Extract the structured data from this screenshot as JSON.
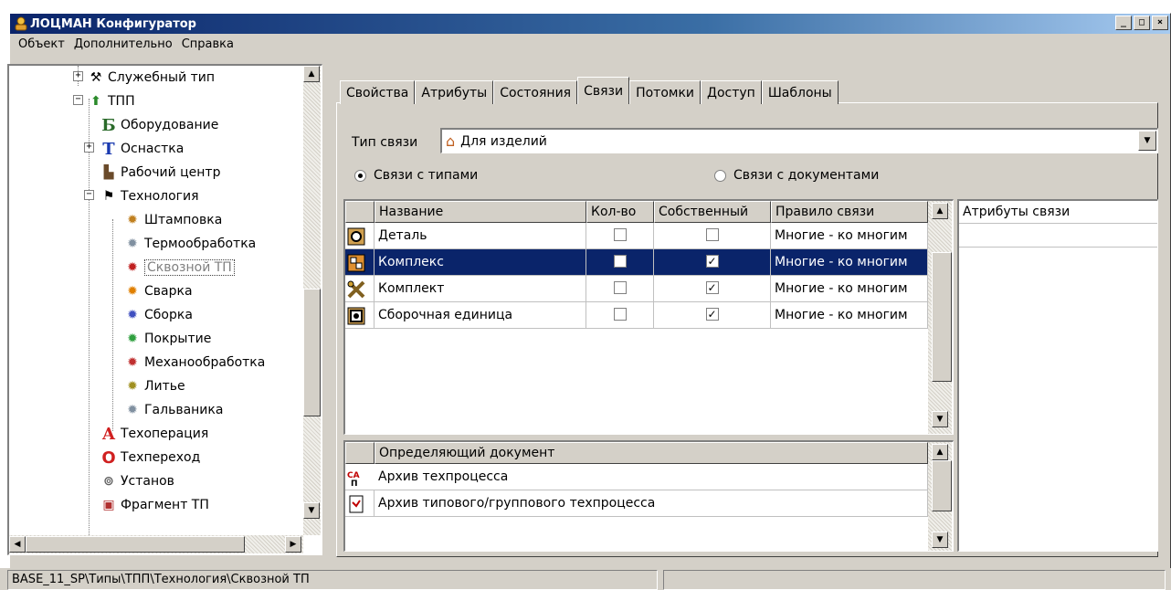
{
  "window": {
    "title": "ЛОЦМАН Конфигуратор",
    "buttons": [
      "_",
      "□",
      "×"
    ]
  },
  "menu": [
    "Объект",
    "Дополнительно",
    "Справка"
  ],
  "tree": {
    "items": [
      {
        "label": "Служебный тип",
        "icon": "tools-icon"
      },
      {
        "label": "ТПП",
        "icon": "folder-arrow-icon"
      },
      {
        "label": "Оборудование",
        "icon": "letter-b-icon",
        "glyph": "Б"
      },
      {
        "label": "Оснастка",
        "icon": "letter-t-icon",
        "glyph": "Т"
      },
      {
        "label": "Рабочий центр",
        "icon": "workcenter-icon"
      },
      {
        "label": "Технология",
        "icon": "technology-icon"
      },
      {
        "label": "Штамповка",
        "icon": "gear-icon"
      },
      {
        "label": "Термообработка",
        "icon": "gear-icon"
      },
      {
        "label": "Сквозной ТП",
        "icon": "gear-red-icon"
      },
      {
        "label": "Сварка",
        "icon": "gear-orange-icon"
      },
      {
        "label": "Сборка",
        "icon": "gear-blue-icon"
      },
      {
        "label": "Покрытие",
        "icon": "gear-green-icon"
      },
      {
        "label": "Механообработка",
        "icon": "gear-red-icon"
      },
      {
        "label": "Литье",
        "icon": "gear-yellow-icon"
      },
      {
        "label": "Гальваника",
        "icon": "gear-icon"
      },
      {
        "label": "Техоперация",
        "icon": "letter-a-icon",
        "glyph": "A"
      },
      {
        "label": "Техпереход",
        "icon": "letter-o-icon",
        "glyph": "O"
      },
      {
        "label": "Установ",
        "icon": "setup-icon"
      },
      {
        "label": "Фрагмент ТП",
        "icon": "fragment-icon"
      }
    ]
  },
  "tabs": [
    "Свойства",
    "Атрибуты",
    "Состояния",
    "Связи",
    "Потомки",
    "Доступ",
    "Шаблоны"
  ],
  "active_tab": "Связи",
  "link_type": {
    "label": "Тип связи",
    "value": "Для изделий"
  },
  "radios": {
    "types": "Связи с типами",
    "documents": "Связи с документами"
  },
  "links_table": {
    "columns": [
      "Название",
      "Кол-во",
      "Собственный",
      "Правило связи"
    ],
    "rows": [
      {
        "name": "Деталь",
        "qty": false,
        "own": false,
        "rule": "Многие - ко многим"
      },
      {
        "name": "Комплекс",
        "qty": false,
        "own": true,
        "rule": "Многие - ко многим"
      },
      {
        "name": "Комплект",
        "qty": false,
        "own": true,
        "rule": "Многие - ко многим"
      },
      {
        "name": "Сборочная единица",
        "qty": false,
        "own": true,
        "rule": "Многие - ко многим"
      }
    ]
  },
  "attributes_panel": {
    "header": "Атрибуты связи"
  },
  "docs_table": {
    "header": "Определяющий документ",
    "rows": [
      "Архив техпроцесса",
      "Архив типового/группового техпроцесса"
    ]
  },
  "status": {
    "path": "BASE_11_SP\\Типы\\ТПП\\Технология\\Сквозной ТП"
  },
  "colors": {
    "selection": "#0a246a",
    "face": "#d4d0c8"
  }
}
